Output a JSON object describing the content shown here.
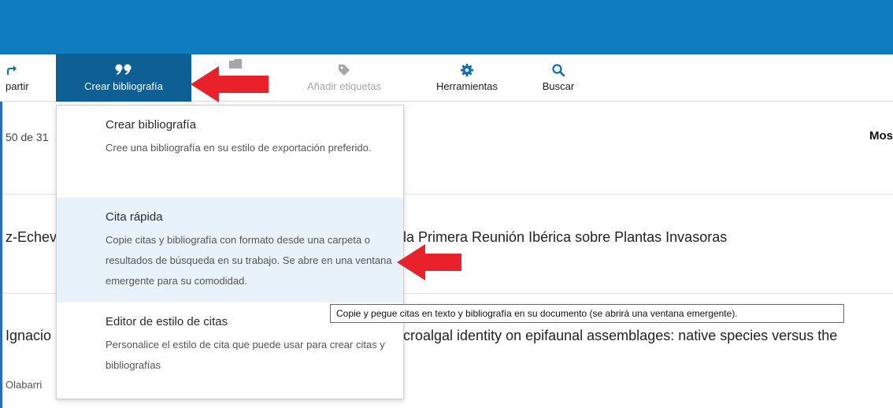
{
  "toolbar": {
    "share_label": "partir",
    "crear_label": "Crear bibliografía",
    "tags_label": "Añadir etiquetas",
    "tools_label": "Herramientas",
    "search_label": "Buscar"
  },
  "dropdown": {
    "items": [
      {
        "title": "Crear bibliografía",
        "desc": "Cree una bibliografía en su estilo de exportación preferido."
      },
      {
        "title": "Cita rápida",
        "desc": "Copie citas y bibliografía con formato desde una carpeta o resultados de búsqueda en su trabajo. Se abre en una ventana emergente para su comodidad."
      },
      {
        "title": "Editor de estilo de citas",
        "desc": "Personalice el estilo de cita que puede usar para crear citas y bibliografías"
      }
    ]
  },
  "tooltip": "Copie y pegue citas en texto y bibliografía en su documento (se abrirá una ventana emergente).",
  "results": {
    "count_fragment": "50 de 31",
    "show_fragment": "Mos",
    "row1_author": "z-Echev",
    "row1_title": "la Primera Reunión Ibérica sobre Plantas Invasoras",
    "row2_author": "Ignacio",
    "row2_title": "croalgal identity on epifaunal assemblages: native species versus the",
    "row2_sub": "Olabarri"
  },
  "colors": {
    "header_blue": "#0f7cc0",
    "active_tab": "#0d5f94",
    "highlight": "#e7f2fa",
    "annotation_arrow": "#e8212a"
  },
  "icons": [
    "share-icon",
    "quote-icon",
    "folder-icon",
    "tag-icon",
    "gear-icon",
    "search-icon"
  ]
}
